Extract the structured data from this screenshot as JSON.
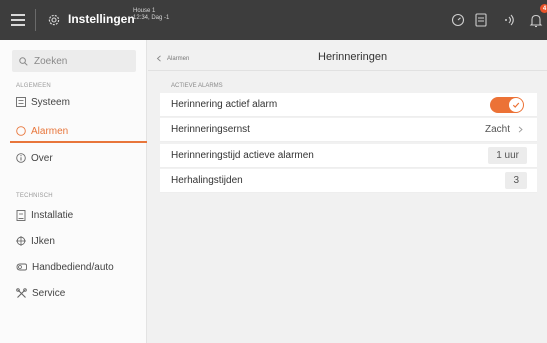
{
  "topbar": {
    "title": "Instellingen",
    "house_line1": "House 1",
    "house_line2": "12:34, Dag -1",
    "notification_count": "4"
  },
  "sidebar": {
    "search_placeholder": "Zoeken",
    "section_general": "ALGEMEEN",
    "section_technical": "TECHNISCH",
    "items": [
      {
        "label": "Systeem",
        "icon": "system-icon"
      },
      {
        "label": "Alarmen",
        "icon": "alarm-icon",
        "active": true
      },
      {
        "label": "Over",
        "icon": "info-icon"
      },
      {
        "label": "Installatie",
        "icon": "installation-icon"
      },
      {
        "label": "IJken",
        "icon": "calibrate-icon"
      },
      {
        "label": "Handbediend/auto",
        "icon": "manual-auto-icon"
      },
      {
        "label": "Service",
        "icon": "service-icon"
      }
    ]
  },
  "main": {
    "breadcrumb_back": "Alarmen",
    "title": "Herinneringen",
    "group_label": "ACTIEVE ALARMS",
    "rows": [
      {
        "label": "Herinnering actief alarm",
        "toggle": true
      },
      {
        "label": "Herinneringsernst",
        "value": "Zacht"
      },
      {
        "label": "Herinneringstijd actieve alarmen",
        "value": "1 uur"
      },
      {
        "label": "Herhalingstijden",
        "value": "3"
      }
    ]
  },
  "colors": {
    "accent": "#e8763b",
    "topbar": "#3d3d3d"
  }
}
